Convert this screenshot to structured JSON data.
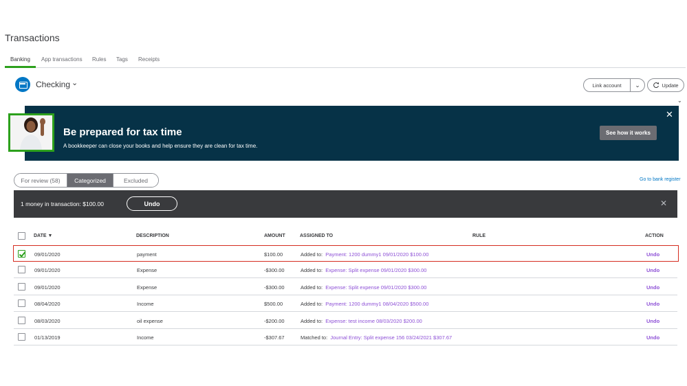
{
  "page": {
    "title": "Transactions"
  },
  "tabs": [
    {
      "label": "Banking",
      "active": true
    },
    {
      "label": "App transactions",
      "active": false
    },
    {
      "label": "Rules",
      "active": false
    },
    {
      "label": "Tags",
      "active": false
    },
    {
      "label": "Receipts",
      "active": false
    }
  ],
  "account": {
    "name": "Checking"
  },
  "toolbar": {
    "link_account_label": "Link account",
    "update_label": "Update"
  },
  "banner": {
    "title": "Be prepared for tax time",
    "subtitle": "A bookkeeper can close your books and help ensure they are clean for tax time.",
    "cta_label": "See how it works"
  },
  "filters": {
    "for_review": "For review (58)",
    "categorized": "Categorized",
    "excluded": "Excluded",
    "bank_register_link": "Go to bank register"
  },
  "notification": {
    "text": "1 money in transaction: $100.00",
    "undo_label": "Undo"
  },
  "table": {
    "headers": {
      "date": "DATE ▼",
      "description": "DESCRIPTION",
      "amount": "AMOUNT",
      "assigned_to": "ASSIGNED TO",
      "rule": "RULE",
      "action": "ACTION"
    },
    "rows": [
      {
        "date": "09/01/2020",
        "description": "payment",
        "amount": "$100.00",
        "assigned_label": "Added to:",
        "assigned_link": "Payment: 1200 dummy1 09/01/2020 $100.00",
        "action": "Undo",
        "checked": true
      },
      {
        "date": "09/01/2020",
        "description": "Expense",
        "amount": "-$300.00",
        "assigned_label": "Added to:",
        "assigned_link": "Expense: Split expense 09/01/2020 $300.00",
        "action": "Undo",
        "checked": false
      },
      {
        "date": "09/01/2020",
        "description": "Expense",
        "amount": "-$300.00",
        "assigned_label": "Added to:",
        "assigned_link": "Expense: Split expense 09/01/2020 $300.00",
        "action": "Undo",
        "checked": false
      },
      {
        "date": "08/04/2020",
        "description": "Income",
        "amount": "$500.00",
        "assigned_label": "Added to:",
        "assigned_link": "Payment: 1200 dummy1 08/04/2020 $500.00",
        "action": "Undo",
        "checked": false
      },
      {
        "date": "08/03/2020",
        "description": "oil expense",
        "amount": "-$200.00",
        "assigned_label": "Added to:",
        "assigned_link": "Expense: test income 08/03/2020 $200.00",
        "action": "Undo",
        "checked": false
      },
      {
        "date": "01/13/2019",
        "description": "Income",
        "amount": "-$307.67",
        "assigned_label": "Matched to:",
        "assigned_link": "Journal Entry: Split expense 156 03/24/2021 $307.67",
        "action": "Undo",
        "checked": false
      }
    ]
  },
  "colors": {
    "brand_green": "#2ca01c",
    "banner_bg": "#063247",
    "link_purple": "#8d4fd6",
    "link_blue": "#0077c5",
    "highlight_red": "#d52b1e"
  }
}
